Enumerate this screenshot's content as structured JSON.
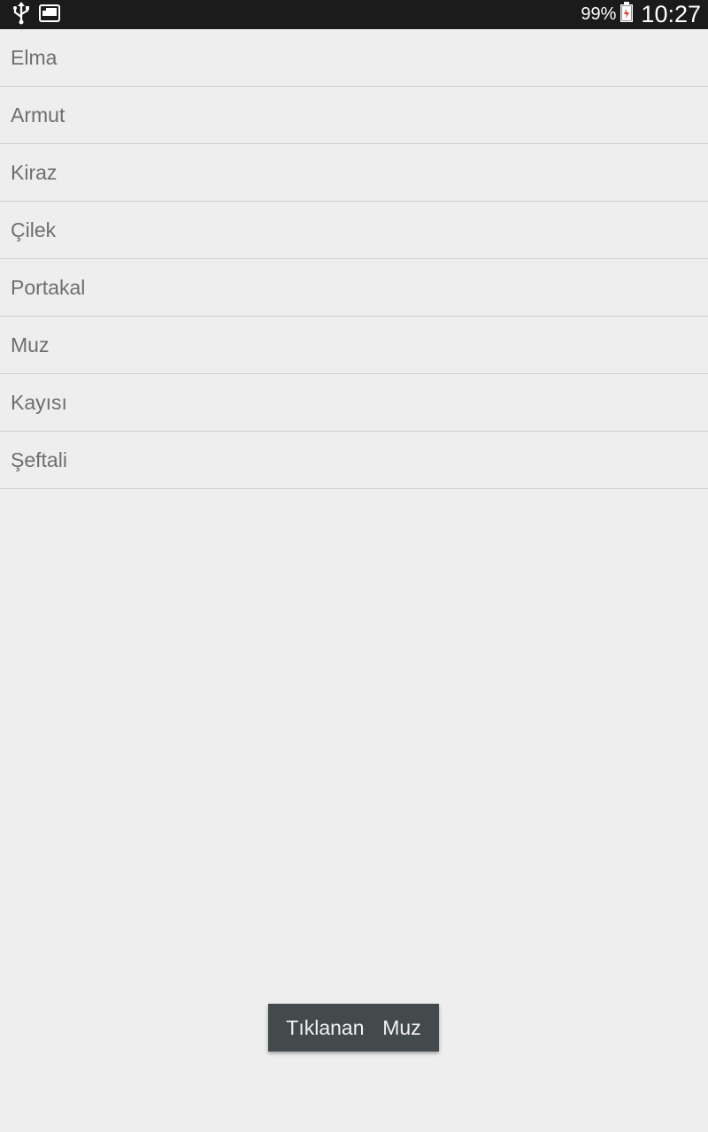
{
  "status_bar": {
    "battery_percent": "99%",
    "time": "10:27",
    "icons": [
      "usb-icon",
      "screenshot-icon",
      "battery-icon"
    ]
  },
  "list": {
    "items": [
      {
        "label": "Elma"
      },
      {
        "label": "Armut"
      },
      {
        "label": "Kiraz"
      },
      {
        "label": "Çilek"
      },
      {
        "label": "Portakal"
      },
      {
        "label": "Muz"
      },
      {
        "label": "Kayısı"
      },
      {
        "label": "Şeftali"
      }
    ]
  },
  "toast": {
    "text": "Tıklanan  Muz"
  },
  "colors": {
    "background": "#eeeeee",
    "status_bar": "#1b1b1b",
    "divider": "#d0d0d0",
    "item_text": "#6e6e6e",
    "toast_bg": "#434a4c",
    "battery_warning": "#e23b2a"
  }
}
